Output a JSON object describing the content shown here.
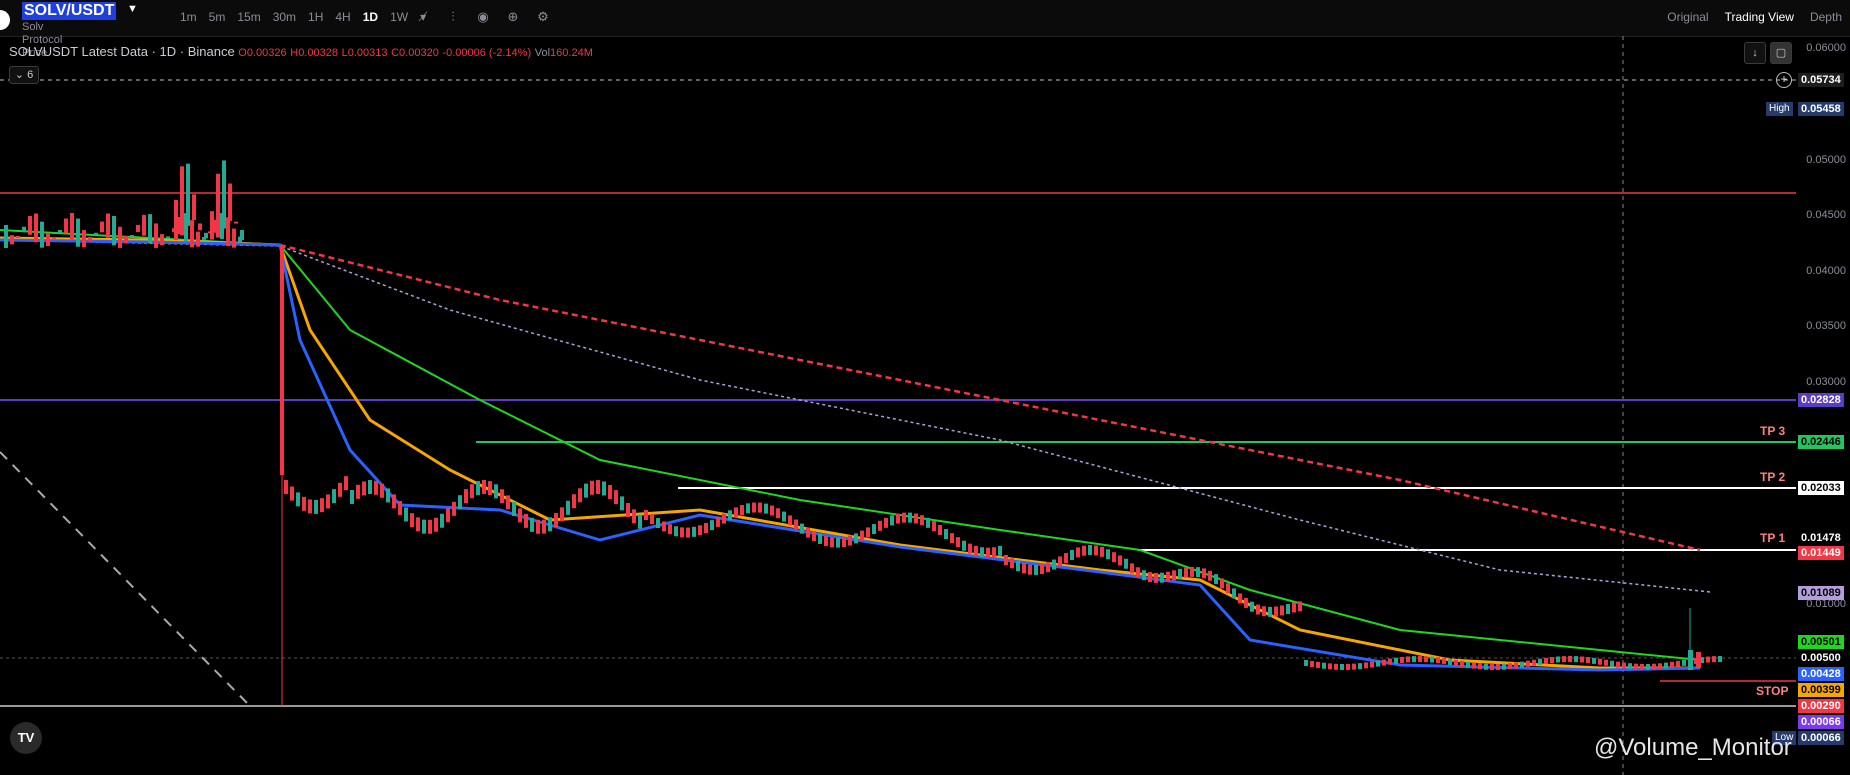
{
  "header": {
    "symbol": "SOLV/USDT",
    "subtitle": "Solv Protocol Price",
    "intervals": [
      "1m",
      "5m",
      "15m",
      "30m",
      "1H",
      "4H",
      "1D",
      "1W"
    ],
    "active_interval": "1D",
    "tools": [
      "indicators-icon",
      "compare-icon",
      "screenshot-icon",
      "plus-circle-icon",
      "settings-icon"
    ],
    "view_tabs": [
      "Original",
      "Trading View",
      "Depth"
    ],
    "active_view": "Trading View"
  },
  "legend": {
    "title": "SOLVUSDT Latest Data · 1D · Binance",
    "open": "O0.00326",
    "high": "H0.00328",
    "low": "L0.00313",
    "close": "C0.00320",
    "change": "-0.00006 (-2.14%)",
    "vol_label": "Vol",
    "vol": "160.24M",
    "indicator_count": "6"
  },
  "price_axis": {
    "ticks": [
      "0.06000",
      "0.05000",
      "0.04500",
      "0.04000",
      "0.03500",
      "0.03000",
      "0.01000"
    ],
    "tags": [
      {
        "value": "0.05734",
        "bg": "#1e1e1e",
        "fg": "#ffffff"
      },
      {
        "value": "0.05458",
        "bg": "#243b6b",
        "fg": "#ffffff"
      },
      {
        "value": "0.02828",
        "bg": "#5b3cc4",
        "fg": "#ffffff"
      },
      {
        "value": "0.02446",
        "bg": "#22c55e",
        "fg": "#000000"
      },
      {
        "value": "0.02033",
        "bg": "#ffffff",
        "fg": "#000000"
      },
      {
        "value": "0.01478",
        "bg": "#000000",
        "fg": "#ffffff"
      },
      {
        "value": "0.01449",
        "bg": "#f23645",
        "fg": "#ffffff"
      },
      {
        "value": "0.01089",
        "bg": "#b39ddb",
        "fg": "#000000"
      },
      {
        "value": "0.00501",
        "bg": "#1fd71f",
        "fg": "#000000"
      },
      {
        "value": "0.00500",
        "bg": "#000000",
        "fg": "#ffffff"
      },
      {
        "value": "0.00428",
        "bg": "#2962ff",
        "fg": "#ffffff"
      },
      {
        "value": "0.00399",
        "bg": "#f7a600",
        "fg": "#000000"
      },
      {
        "value": "0.00290",
        "bg": "#f23645",
        "fg": "#ffffff"
      },
      {
        "value": "0.00066",
        "bg": "#7c3aed",
        "fg": "#ffffff"
      },
      {
        "value": "0.00066",
        "bg": "#243b6b",
        "fg": "#ffffff"
      }
    ],
    "high_label": "High",
    "low_label": "Low"
  },
  "levels": {
    "tp3": "TP 3",
    "tp2": "TP 2",
    "tp1": "TP 1",
    "stop": "STOP"
  },
  "colors": {
    "up": "#22ab94",
    "down": "#f23645",
    "ema_fast": "#2962ff",
    "ema_mid": "#f7a600",
    "ema_slow": "#1fd71f",
    "ma_red_dashed": "#f23645",
    "ma_lilac_dotted": "#b39ddb",
    "resistance_red": "#f23645",
    "resistance_purple": "#5b3cc4"
  },
  "watermark": "@Volume_Monitor",
  "logo_text": "TV"
}
